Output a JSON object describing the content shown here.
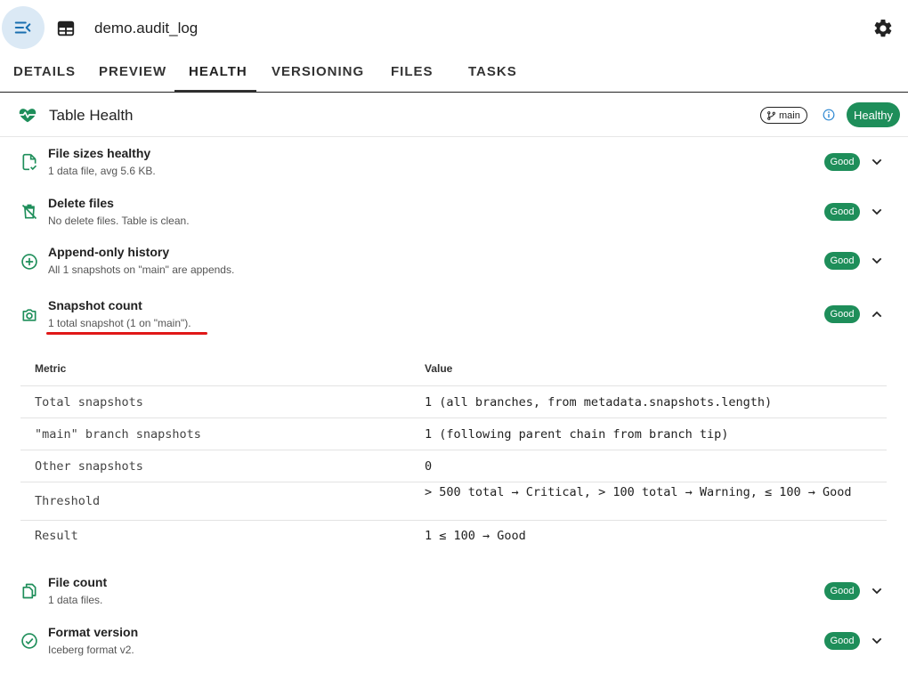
{
  "header": {
    "title": "demo.audit_log"
  },
  "tabs": [
    {
      "label": "DETAILS"
    },
    {
      "label": "PREVIEW"
    },
    {
      "label": "HEALTH"
    },
    {
      "label": "VERSIONING"
    },
    {
      "label": "FILES"
    },
    {
      "label": "TASKS"
    }
  ],
  "health": {
    "title": "Table Health",
    "branch": "main",
    "status": "Healthy"
  },
  "checks": [
    {
      "title": "File sizes healthy",
      "subtitle": "1 data file, avg 5.6 KB.",
      "badge": "Good",
      "icon": "file-check-icon"
    },
    {
      "title": "Delete files",
      "subtitle": "No delete files. Table is clean.",
      "badge": "Good",
      "icon": "delete-off-icon"
    },
    {
      "title": "Append-only history",
      "subtitle": "All 1 snapshots on \"main\" are appends.",
      "badge": "Good",
      "icon": "add-circle-icon"
    },
    {
      "title": "Snapshot count",
      "subtitle": "1 total snapshot (1 on \"main\").",
      "badge": "Good",
      "icon": "camera-icon"
    },
    {
      "title": "File count",
      "subtitle": "1 data files.",
      "badge": "Good",
      "icon": "files-icon"
    },
    {
      "title": "Format version",
      "subtitle": "Iceberg format v2.",
      "badge": "Good",
      "icon": "check-circle-icon"
    }
  ],
  "details_table": {
    "headers": {
      "metric": "Metric",
      "value": "Value"
    },
    "rows": [
      {
        "metric": "Total snapshots",
        "value": "1 (all branches, from metadata.snapshots.length)"
      },
      {
        "metric": "\"main\" branch snapshots",
        "value": "1 (following parent chain from branch tip)"
      },
      {
        "metric": "Other snapshots",
        "value": "0"
      },
      {
        "metric": "Threshold",
        "value": "> 500 total → Critical, > 100 total → Warning, ≤ 100 → Good"
      },
      {
        "metric": "Result",
        "value": "1 ≤ 100 → Good"
      }
    ]
  },
  "colors": {
    "accent": "#1e8e5a",
    "highlight": "#e01818",
    "menu_bg": "#dbe9f5"
  }
}
